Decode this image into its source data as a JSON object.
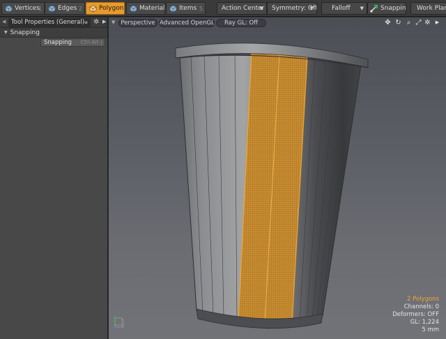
{
  "toolbar": {
    "modes": [
      {
        "label": "Vertices",
        "key": "1",
        "icon": "vertex-cube-icon",
        "active": false
      },
      {
        "label": "Edges",
        "key": "2",
        "icon": "edge-cube-icon",
        "active": false
      },
      {
        "label": "Polygons",
        "key": "",
        "icon": "polygon-cube-icon",
        "active": true
      },
      {
        "label": "Materials",
        "key": "",
        "icon": "material-cube-icon",
        "active": false
      },
      {
        "label": "Items",
        "key": "5",
        "icon": "item-cube-icon",
        "active": false
      }
    ],
    "action_center": "Action Center",
    "symmetry": "Symmetry: Off",
    "falloff": "Falloff",
    "snapping": "Snapping",
    "work_plane": "Work Plane"
  },
  "panel": {
    "tab_title": "Tool Properties (General)",
    "tab_suffix": "w",
    "section": "Snapping",
    "snap_button": "Snapping",
    "snap_shortcut": "Ctrl-Alt-J"
  },
  "viewport": {
    "view_mode": "Perspective",
    "renderer": "Advanced OpenGL",
    "ray_gl": "Ray GL: Off",
    "stats": {
      "selection": "2 Polygons",
      "channels": "Channels: 0",
      "deformers": "Deformers: OFF",
      "gl": "GL: 1,224",
      "grid": "5 mm"
    }
  },
  "colors": {
    "accent": "#e89a2c",
    "selection": "#f0a832",
    "background": "#5c5e65"
  }
}
